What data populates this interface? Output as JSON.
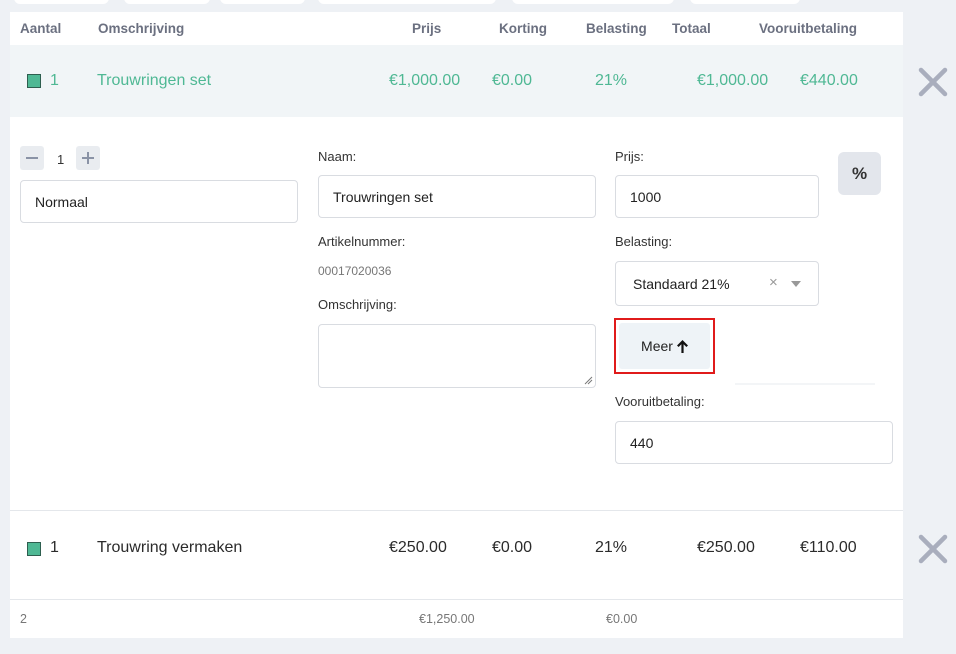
{
  "columns": {
    "aantal": "Aantal",
    "omschrijving": "Omschrijving",
    "prijs": "Prijs",
    "korting": "Korting",
    "belasting": "Belasting",
    "totaal": "Totaal",
    "vooruitbetaling": "Vooruitbetaling"
  },
  "rows": [
    {
      "qty": "1",
      "description": "Trouwringen set",
      "price": "€1,000.00",
      "discount": "€0.00",
      "tax": "21%",
      "total": "€1,000.00",
      "prepayment": "€440.00"
    },
    {
      "qty": "1",
      "description": "Trouwring vermaken",
      "price": "€250.00",
      "discount": "€0.00",
      "tax": "21%",
      "total": "€250.00",
      "prepayment": "€110.00"
    }
  ],
  "editor": {
    "quantity": "1",
    "type_value": "Normaal",
    "naam_label": "Naam:",
    "naam_value": "Trouwringen set",
    "artikelnummer_label": "Artikelnummer:",
    "artikelnummer_value": "00017020036",
    "omschrijving_label": "Omschrijving:",
    "omschrijving_value": "",
    "prijs_label": "Prijs:",
    "prijs_value": "1000",
    "percent_button": "%",
    "belasting_label": "Belasting:",
    "belasting_value": "Standaard 21%",
    "meer_label": "Meer",
    "vooruitbetaling_label": "Vooruitbetaling:",
    "vooruitbetaling_value": "440"
  },
  "footer": {
    "count": "2",
    "sum_price": "€1,250.00",
    "sum_discount": "€0.00"
  },
  "colors": {
    "accent_green": "#4fb894",
    "highlight_red": "#e01b1b",
    "remove_icon": "#a9aebd"
  }
}
